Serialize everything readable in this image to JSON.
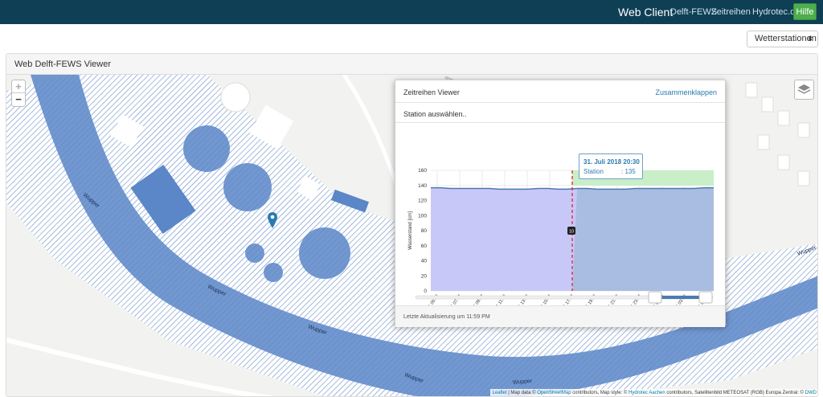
{
  "navbar": {
    "brand": "Web Client",
    "links": [
      "Delft-FEWS",
      "Zeitreihen",
      "Hydrotec.de"
    ],
    "help": "Hilfe",
    "bg_color": "#0f3f55"
  },
  "station_select": {
    "value": "Wetterstationen"
  },
  "panel": {
    "title": "Web Delft-FEWS Viewer"
  },
  "map": {
    "zoom_in": "+",
    "zoom_out": "−",
    "river_label": "Wupper",
    "street_label": "ringer Str.",
    "water_color": "#5b86c8",
    "attribution": {
      "leaflet": "Leaflet",
      "text1": " | Map data © ",
      "osm": "OpenStreetMap",
      "text2": " contributors, Map style: © ",
      "hydrotec": "Hydrotec Aachen",
      "text3": " contributors, Satellitenbild METEOSAT (RGB) Europa Zentral: © ",
      "dwd": "DWD"
    }
  },
  "viewer": {
    "title": "Zeitreihen Viewer",
    "collapse": "Zusammenklappen",
    "station_prompt": "Station auswählen..",
    "footer": "Letzte Aktualisierung um 11:59 PM",
    "tooltip": {
      "date": "31. Juli 2018 20:30",
      "label": "Station",
      "value": ": 135"
    },
    "now_badge": "10"
  },
  "chart_data": {
    "type": "area",
    "ylabel": "Wasserstand [cm]",
    "ylim": [
      0,
      160
    ],
    "yticks": [
      "0",
      "20",
      "40",
      "60",
      "80",
      "100",
      "120",
      "140",
      "160"
    ],
    "xticks": [
      "07.31 05:07",
      "07.31 07:07",
      "07.31 09:07",
      "07.31 11:07",
      "07.31 13:07",
      "07.31 15:07",
      "07.31 17:07",
      "07.31 19:07",
      "07.31 21:07",
      "07.31 23:07",
      "08.01 01:08",
      "08.01 03:08",
      "08.01 05:08"
    ],
    "series": [
      {
        "values": [
          137,
          137,
          136,
          136,
          136,
          136,
          136,
          135,
          135,
          135,
          135,
          136,
          136,
          135,
          135,
          136,
          136,
          135,
          135,
          135,
          135,
          136,
          136,
          136,
          136,
          136,
          136,
          136,
          137,
          137
        ]
      }
    ],
    "forecast_start_fraction": 0.5,
    "colors": {
      "observed": "#c8c8f8",
      "forecast": "#a9bde3",
      "forecast_band": "#c9efc8",
      "line": "#4a7bb0",
      "now": "#e03030"
    }
  }
}
